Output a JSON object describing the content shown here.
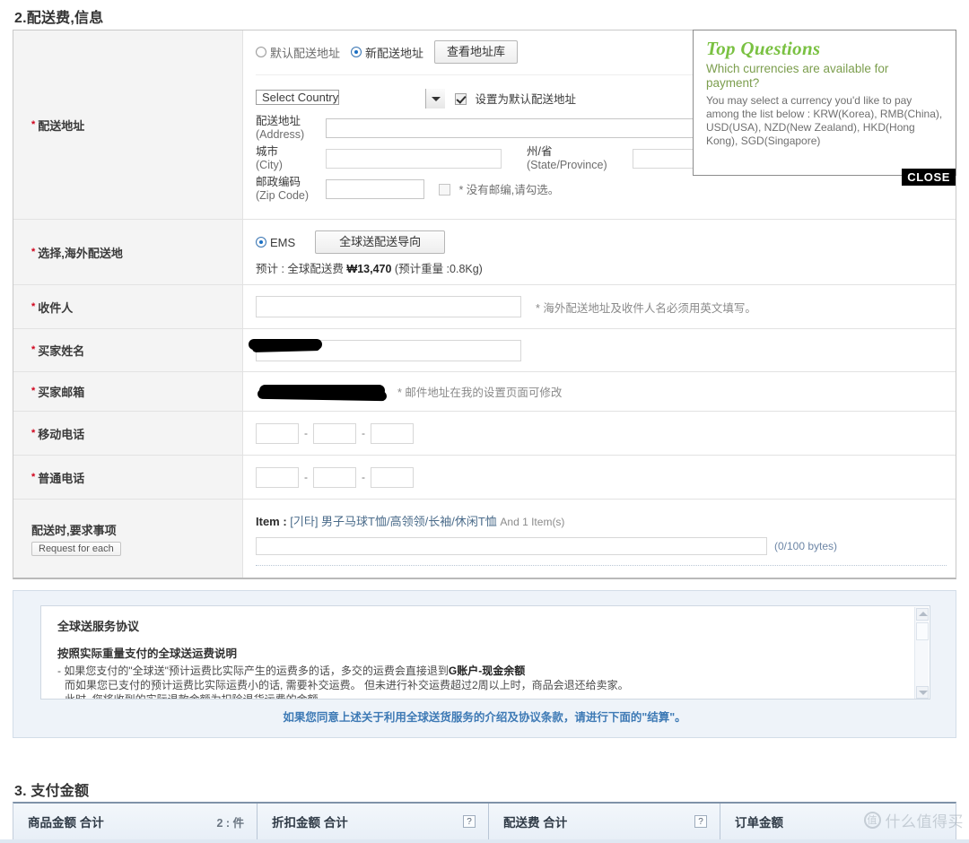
{
  "sections": {
    "shipping_heading": "2.配送费,信息",
    "payment_heading": "3. 支付金额"
  },
  "address_row": {
    "label": "配送地址",
    "radio_default": "默认配送地址",
    "radio_new": "新配送地址",
    "address_book_button": "查看地址库",
    "country_select_value": "Select Country",
    "set_default_checkbox_label": "设置为默认配送地址",
    "fields": [
      {
        "cn": "配送地址",
        "en": "(Address)",
        "value": ""
      },
      {
        "cn": "城市",
        "en": "(City)",
        "value": ""
      },
      {
        "cn": "州/省",
        "en": "(State/Province)",
        "value": ""
      },
      {
        "cn": "邮政编码",
        "en": "(Zip Code)",
        "value": ""
      }
    ],
    "no_zip_note": "* 没有邮编,请勾选。"
  },
  "overseas_row": {
    "label": "选择,海外配送地",
    "carrier": "EMS",
    "guide_button": "全球送配送导向",
    "estimate_prefix": "预计 : 全球配送费 ",
    "estimate_amount": "₩13,470",
    "estimate_suffix": " (预计重量 :0.8Kg)"
  },
  "recipient_row": {
    "label": "收件人",
    "value": "",
    "note": "* 海外配送地址及收件人名必须用英文填写。"
  },
  "buyer_name_row": {
    "label": "买家姓名",
    "value": ""
  },
  "buyer_email_row": {
    "label": "买家邮箱",
    "value": "",
    "note": "* 邮件地址在我的设置页面可修改"
  },
  "mobile_phone_row": {
    "label": "移动电话",
    "part1": "",
    "part2": "",
    "part3": "",
    "separator": "-"
  },
  "home_phone_row": {
    "label": "普通电话",
    "part1": "",
    "part2": "",
    "part3": "",
    "separator": "-"
  },
  "request_row": {
    "label": "配送时,要求事项",
    "each_button": "Request for each",
    "item_key": "Item :",
    "item_value": "[기타] 男子马球T恤/高领领/长袖/休闲T恤",
    "item_more": "And 1 Item(s)",
    "request_value": "",
    "byte_counter": "(0/100 bytes)"
  },
  "top_questions": {
    "title": "Top Questions",
    "question": "Which currencies are available for payment?",
    "answer": "You may select a currency you'd like to pay among the list below : KRW(Korea), RMB(China), USD(USA), NZD(New Zealand), HKD(Hong Kong), SGD(Singapore)",
    "close_label": "CLOSE",
    "title_color": "#7ac142"
  },
  "agreement": {
    "title": "全球送服务协议",
    "subtitle": "按照实际重量支付的全球送运费说明",
    "line1_a": "- 如果您支付的\"全球送\"预计运费比实际产生的运费多的话，多交的运费会直接退到",
    "line1_b": "G账户-现金余额",
    "line2": "而如果您已支付的预计运费比实际运费小的话, 需要补交运费。 但未进行补交运费超过2周以上时，商品会退还给卖家。",
    "line3": "此时, 您将收到的实际退款金额为扣除退货运费的金额。",
    "footer": "如果您同意上述关于利用全球送货服务的介绍及协议条款，请进行下面的\"结算\"。",
    "footer_color": "#3e7ab5"
  },
  "payment_summary": {
    "cells": [
      {
        "label": "商品金额 合计",
        "extra": "2 : 件",
        "help": false
      },
      {
        "label": "折扣金额 合计",
        "extra": "",
        "help": true
      },
      {
        "label": "配送费 合计",
        "extra": "",
        "help": true
      },
      {
        "label": "订单金额",
        "extra": "",
        "help": false
      }
    ],
    "help_glyph": "?"
  },
  "watermark": {
    "badge": "值",
    "text": "什么值得买"
  }
}
